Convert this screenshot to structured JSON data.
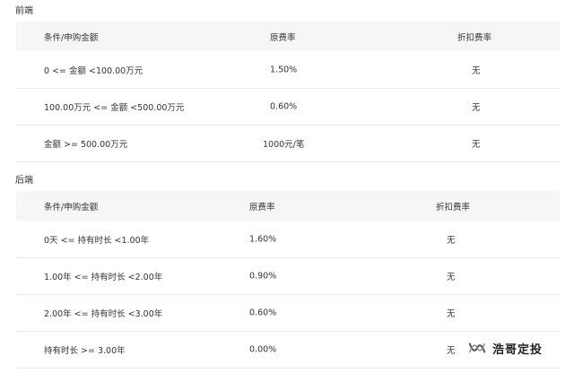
{
  "front": {
    "title": "前端",
    "headers": [
      "条件/申购金额",
      "原费率",
      "折扣费率"
    ],
    "rows": [
      [
        "0 <= 金额 <100.00万元",
        "1.50%",
        "无"
      ],
      [
        "100.00万元 <= 金额 <500.00万元",
        "0.60%",
        "无"
      ],
      [
        "金额 >= 500.00万元",
        "1000元/笔",
        "无"
      ]
    ]
  },
  "back": {
    "title": "后端",
    "headers": [
      "条件/申购金额",
      "原费率",
      "折扣费率"
    ],
    "rows": [
      [
        "0天 <= 持有时长 <1.00年",
        "1.60%",
        "无"
      ],
      [
        "1.00年 <= 持有时长 <2.00年",
        "0.90%",
        "无"
      ],
      [
        "2.00年 <= 持有时长 <3.00年",
        "0.60%",
        "无"
      ],
      [
        "持有时长 >= 3.00年",
        "0.00%",
        "无"
      ]
    ]
  },
  "watermark": {
    "text": "浩哥定投",
    "icon": "wechat-channel-icon"
  }
}
